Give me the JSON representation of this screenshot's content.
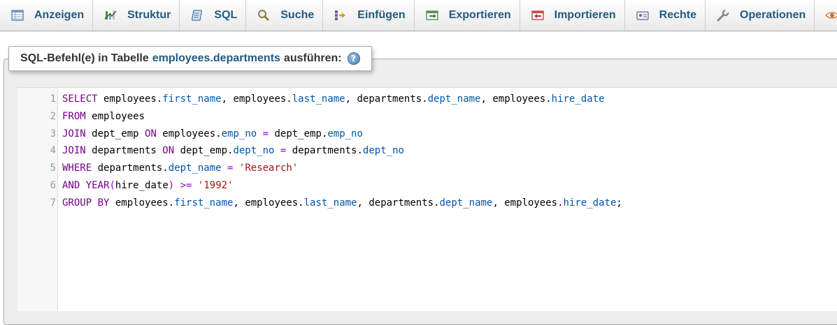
{
  "tabs": [
    {
      "label": "Anzeigen",
      "icon": "table-icon"
    },
    {
      "label": "Struktur",
      "icon": "structure-icon"
    },
    {
      "label": "SQL",
      "icon": "sql-icon"
    },
    {
      "label": "Suche",
      "icon": "search-icon"
    },
    {
      "label": "Einfügen",
      "icon": "insert-icon"
    },
    {
      "label": "Exportieren",
      "icon": "export-icon"
    },
    {
      "label": "Importieren",
      "icon": "import-icon"
    },
    {
      "label": "Rechte",
      "icon": "privileges-icon"
    },
    {
      "label": "Operationen",
      "icon": "wrench-icon"
    },
    {
      "label": "",
      "icon": "eye-icon"
    }
  ],
  "sql_panel": {
    "legend_prefix": "SQL-Befehl(e) in Tabelle",
    "table_name": "employees.departments",
    "legend_suffix": "ausführen:",
    "help_icon": "?"
  },
  "editor": {
    "lines": [
      "SELECT employees.first_name, employees.last_name, departments.dept_name, employees.hire_date",
      "FROM employees",
      "JOIN dept_emp ON employees.emp_no = dept_emp.emp_no",
      "JOIN departments ON dept_emp.dept_no = departments.dept_no",
      "WHERE departments.dept_name = 'Research'",
      "AND YEAR(hire_date) >= '1992'",
      "GROUP BY employees.first_name, employees.last_name, departments.dept_name, employees.hire_date;"
    ]
  },
  "colors": {
    "tab_text": "#235a81",
    "keyword": "#770088",
    "property": "#0055aa",
    "string": "#aa1111",
    "operator": "#9900cc"
  }
}
